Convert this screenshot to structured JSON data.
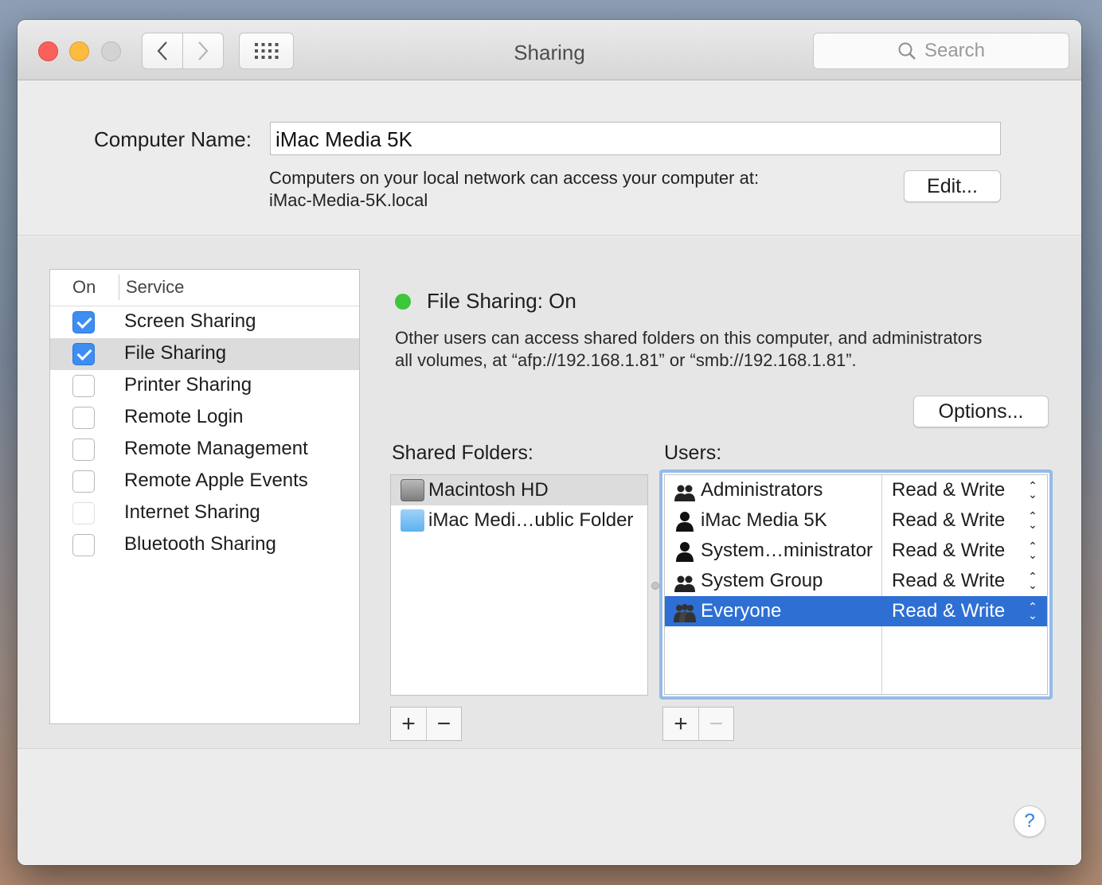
{
  "window": {
    "title": "Sharing",
    "search_placeholder": "Search",
    "nav_back_icon": "chevron-left-icon",
    "nav_forward_icon": "chevron-right-icon",
    "show_all_icon": "grid-icon"
  },
  "computer_name": {
    "label": "Computer Name:",
    "value": "iMac Media 5K",
    "info_line1": "Computers on your local network can access your computer at:",
    "info_line2": "iMac-Media-5K.local",
    "edit_label": "Edit..."
  },
  "services": {
    "header_on": "On",
    "header_service": "Service",
    "items": [
      {
        "label": "Screen Sharing",
        "checked": true,
        "selected": false
      },
      {
        "label": "File Sharing",
        "checked": true,
        "selected": true
      },
      {
        "label": "Printer Sharing",
        "checked": false,
        "selected": false
      },
      {
        "label": "Remote Login",
        "checked": false,
        "selected": false
      },
      {
        "label": "Remote Management",
        "checked": false,
        "selected": false
      },
      {
        "label": "Remote Apple Events",
        "checked": false,
        "selected": false
      },
      {
        "label": "Internet Sharing",
        "checked": false,
        "selected": false
      },
      {
        "label": "Bluetooth Sharing",
        "checked": false,
        "selected": false
      }
    ]
  },
  "detail": {
    "status": "File Sharing: On",
    "status_color": "#3dc63a",
    "description_line1": "Other users can access shared folders on this computer, and administrators",
    "description_line2": "all volumes, at “afp://192.168.1.81” or “smb://192.168.1.81”.",
    "options_label": "Options...",
    "shared_folders_label": "Shared Folders:",
    "users_label": "Users:",
    "shared_folders": [
      {
        "label": "Macintosh HD",
        "icon": "hard-disk-icon",
        "selected": true
      },
      {
        "label": "iMac Medi…ublic Folder",
        "icon": "public-folder-icon",
        "selected": false
      }
    ],
    "users": [
      {
        "name": "Administrators",
        "permission": "Read & Write",
        "icon": "group-icon",
        "selected": false
      },
      {
        "name": "iMac Media 5K",
        "permission": "Read & Write",
        "icon": "user-icon",
        "selected": false
      },
      {
        "name": "System…ministrator",
        "permission": "Read & Write",
        "icon": "user-icon",
        "selected": false
      },
      {
        "name": "System Group",
        "permission": "Read & Write",
        "icon": "group-icon",
        "selected": false
      },
      {
        "name": "Everyone",
        "permission": "Read & Write",
        "icon": "everyone-icon",
        "selected": true
      }
    ],
    "add_symbol": "+",
    "remove_symbol": "−"
  },
  "help_symbol": "?",
  "colors": {
    "selection_blue": "#2e6fd4",
    "checkbox_blue": "#3d8ef3",
    "focus_ring": "#93bbe9"
  }
}
